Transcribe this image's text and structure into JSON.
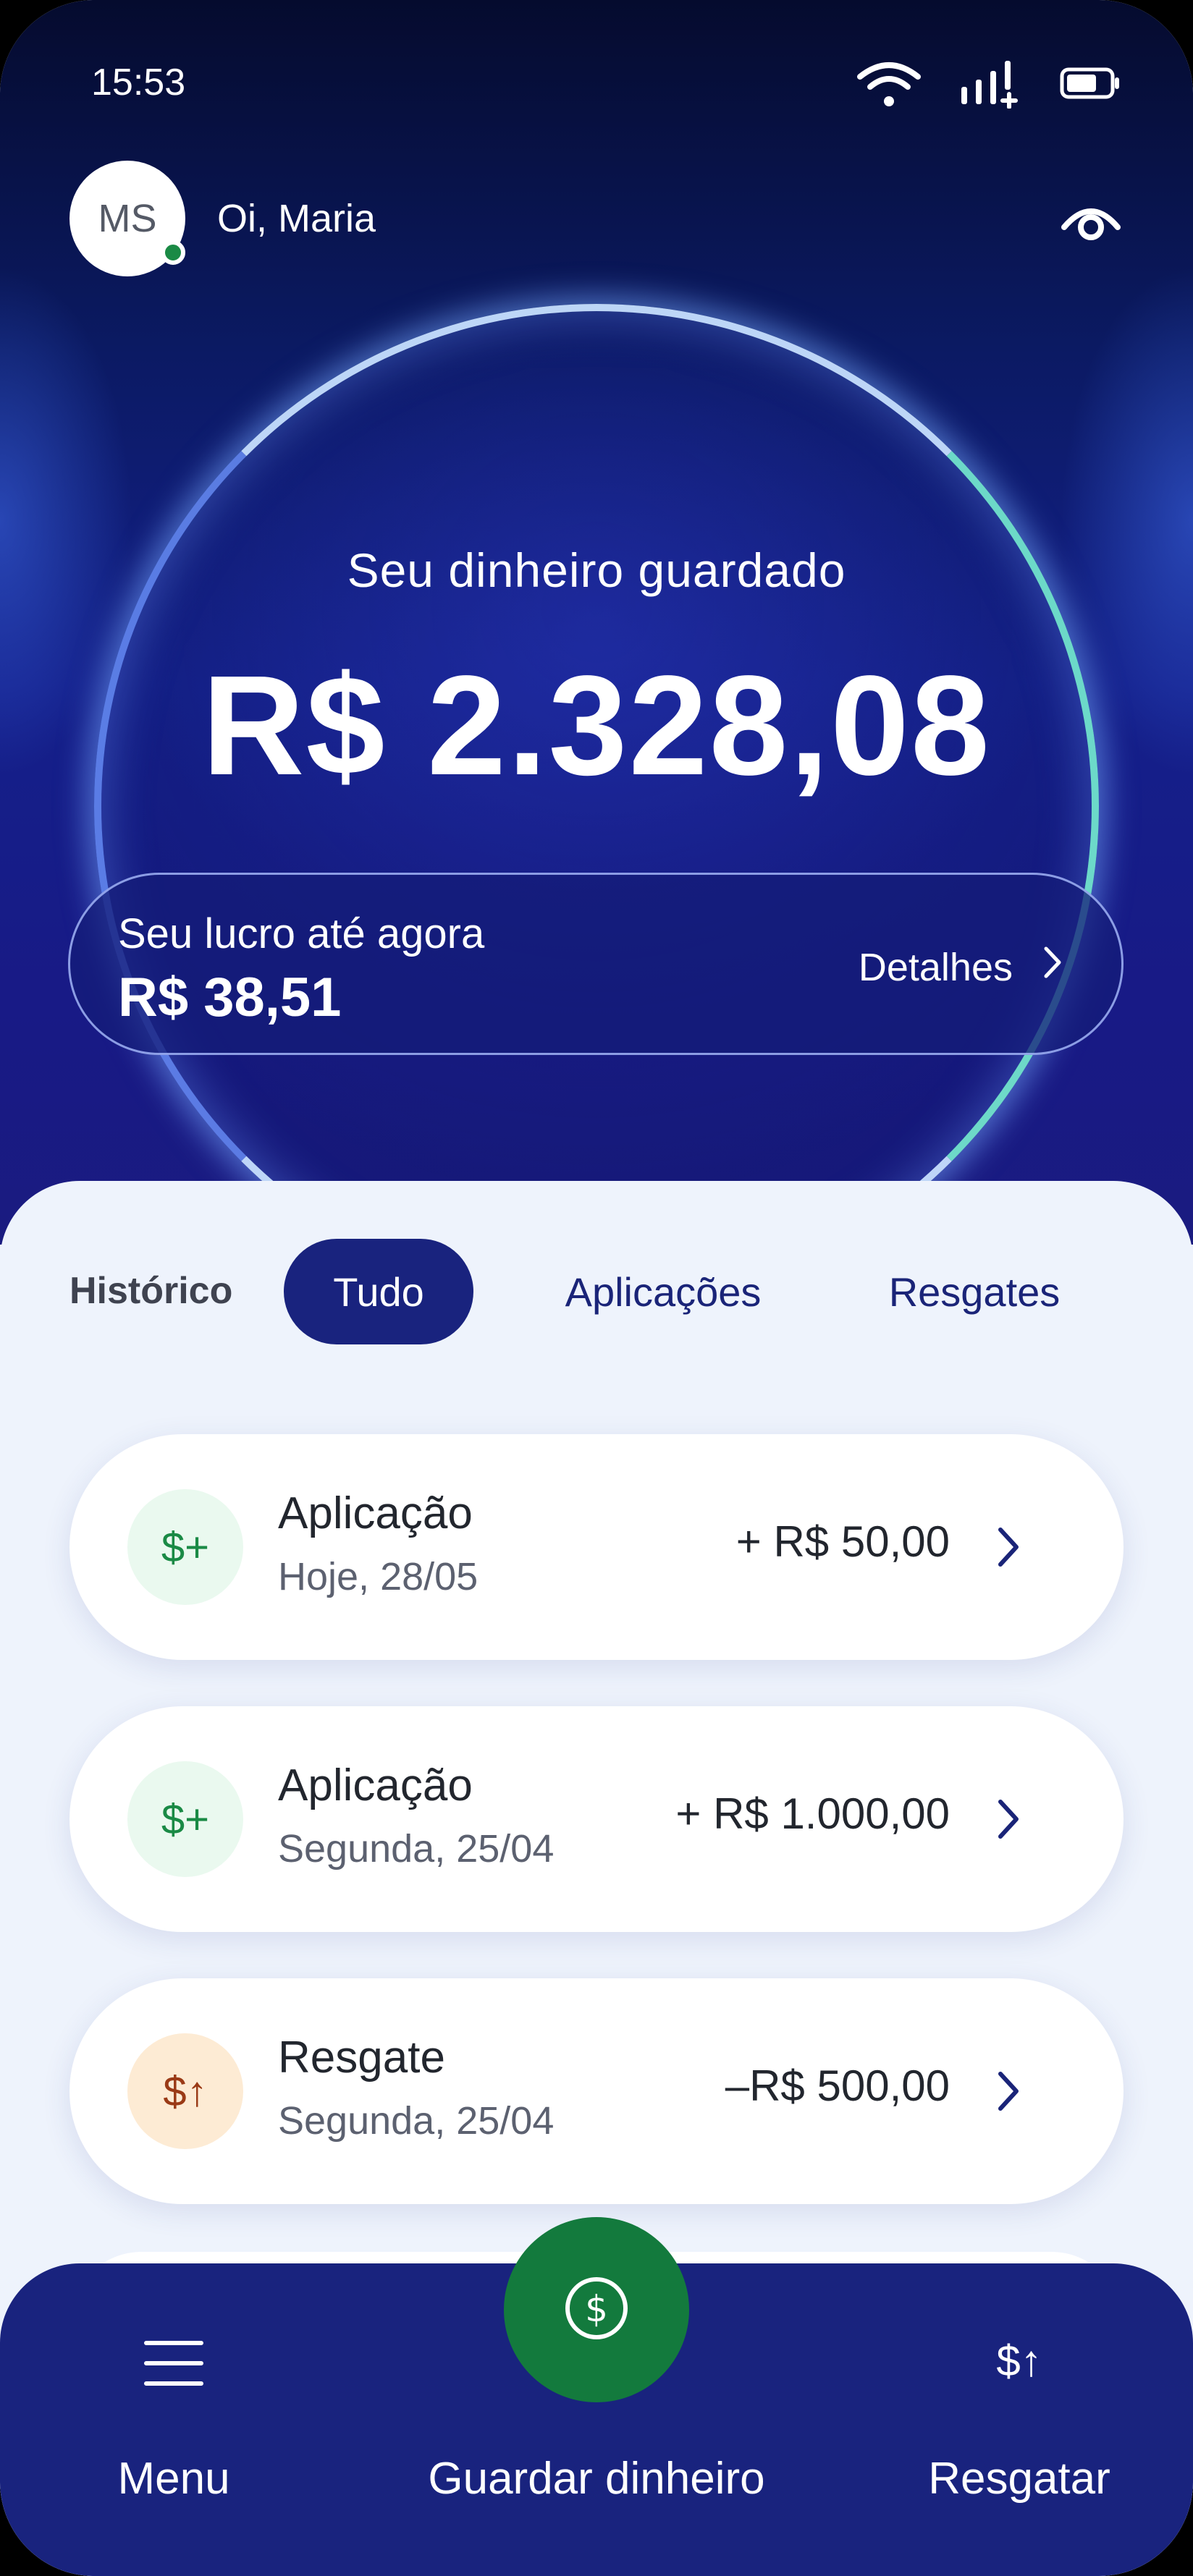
{
  "status_bar": {
    "time": "15:53"
  },
  "user": {
    "initials": "MS",
    "greeting": "Oi, Maria"
  },
  "balance": {
    "label": "Seu dinheiro guardado",
    "value": "R$ 2.328,08"
  },
  "profit": {
    "label": "Seu lucro até agora",
    "value": "R$ 38,51",
    "details_label": "Detalhes"
  },
  "history": {
    "label": "Histórico",
    "filters": [
      {
        "label": "Tudo",
        "active": true
      },
      {
        "label": "Aplicações",
        "active": false
      },
      {
        "label": "Resgates",
        "active": false
      }
    ],
    "transactions": [
      {
        "icon": "$+",
        "type": "in",
        "title": "Aplicação",
        "date": "Hoje, 28/05",
        "amount": "+ R$ 50,00"
      },
      {
        "icon": "$+",
        "type": "in",
        "title": "Aplicação",
        "date": "Segunda, 25/04",
        "amount": "+ R$ 1.000,00"
      },
      {
        "icon": "$↑",
        "type": "out",
        "title": "Resgate",
        "date": "Segunda, 25/04",
        "amount": "–R$ 500,00"
      }
    ]
  },
  "bottom_nav": {
    "menu_label": "Menu",
    "primary_label": "Guardar dinheiro",
    "withdraw_icon": "$↑",
    "withdraw_label": "Resgatar"
  },
  "colors": {
    "primary": "#19237e",
    "positive": "#1a8a45",
    "withdraw": "#9a3a16",
    "background": "#eef3fc"
  }
}
